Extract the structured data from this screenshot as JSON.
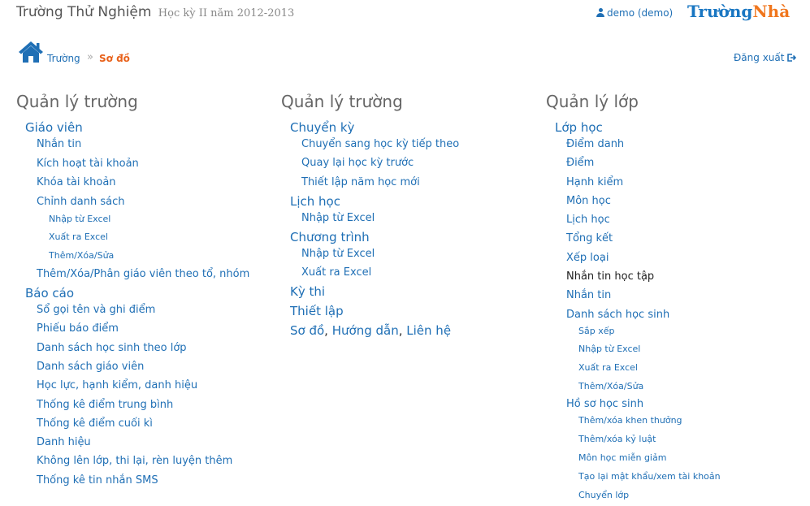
{
  "header": {
    "school_name": "Trường Thử Nghiệm",
    "term": "Học kỳ II năm 2012-2013",
    "user": "demo (demo)",
    "logo_part1": "Trường",
    "logo_part2": "Nhà"
  },
  "breadcrumb": {
    "home": "Trường",
    "separator": "»",
    "current": "Sơ đồ"
  },
  "logout_label": "Đăng xuất",
  "colors": {
    "link": "#1f6fb5",
    "accent": "#e8611a",
    "logo_orange": "#f0761d"
  },
  "columns": [
    {
      "title": "Quản lý trường",
      "groups": [
        {
          "label": "Giáo viên",
          "items": [
            {
              "label": "Nhắn tin"
            },
            {
              "label": "Kích hoạt tài khoản"
            },
            {
              "label": "Khóa tài khoản"
            },
            {
              "label": "Chỉnh danh sách",
              "sub": [
                "Nhập từ Excel",
                "Xuất ra Excel",
                "Thêm/Xóa/Sửa"
              ]
            },
            {
              "label": "Thêm/Xóa/Phân giáo viên theo tổ, nhóm"
            }
          ]
        },
        {
          "label": "Báo cáo",
          "items": [
            {
              "label": "Sổ gọi tên và ghi điểm"
            },
            {
              "label": "Phiếu báo điểm"
            },
            {
              "label": "Danh sách học sinh theo lớp"
            },
            {
              "label": "Danh sách giáo viên"
            },
            {
              "label": "Học lực, hạnh kiểm, danh hiệu"
            },
            {
              "label": "Thống kê điểm trung bình"
            },
            {
              "label": "Thống kê điểm cuối kì"
            },
            {
              "label": "Danh hiệu"
            },
            {
              "label": "Không lên lớp, thi lại, rèn luyện thêm"
            },
            {
              "label": "Thống kê tin nhắn SMS"
            }
          ]
        }
      ]
    },
    {
      "title": "Quản lý trường",
      "groups": [
        {
          "label": "Chuyển kỳ",
          "items": [
            {
              "label": "Chuyển sang học kỳ tiếp theo"
            },
            {
              "label": "Quay lại học kỳ trước"
            },
            {
              "label": "Thiết lập năm học mới"
            }
          ]
        },
        {
          "label": "Lịch học",
          "items": [
            {
              "label": "Nhập từ Excel"
            }
          ]
        },
        {
          "label": "Chương trình",
          "items": [
            {
              "label": "Nhập từ Excel"
            },
            {
              "label": "Xuất ra Excel"
            }
          ]
        },
        {
          "label": "Kỳ thi",
          "items": []
        },
        {
          "label": "Thiết lập",
          "items": []
        }
      ],
      "footer_links": [
        "Sơ đồ",
        "Hướng dẫn",
        "Liên hệ"
      ],
      "footer_sep": ","
    },
    {
      "title": "Quản lý lớp",
      "groups": [
        {
          "label": "Lớp học",
          "items": [
            {
              "label": "Điểm danh"
            },
            {
              "label": "Điểm"
            },
            {
              "label": "Hạnh kiểm"
            },
            {
              "label": "Môn học"
            },
            {
              "label": "Lịch học"
            },
            {
              "label": "Tổng kết"
            },
            {
              "label": "Xếp loại"
            },
            {
              "label": "Nhắn tin học tập",
              "active": true
            },
            {
              "label": "Nhắn tin"
            },
            {
              "label": "Danh sách học sinh",
              "sub": [
                "Sắp xếp",
                "Nhập từ Excel",
                "Xuất ra Excel",
                "Thêm/Xóa/Sửa"
              ]
            },
            {
              "label": "Hồ sơ học sinh",
              "sub": [
                "Thêm/xóa khen thưởng",
                "Thêm/xóa kỷ luật",
                "Môn học miễn giảm",
                "Tạo lại mật khẩu/xem tài khoản",
                "Chuyển lớp"
              ]
            }
          ]
        }
      ]
    }
  ]
}
